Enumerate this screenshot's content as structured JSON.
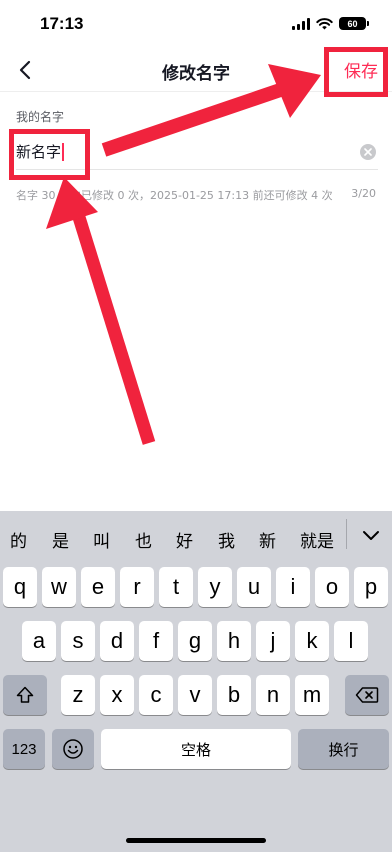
{
  "status_bar": {
    "time": "17:13",
    "battery": "60"
  },
  "nav": {
    "title": "修改名字",
    "save_label": "保存"
  },
  "form": {
    "label": "我的名字",
    "value": "新名字",
    "hint": "名字 30 天内已修改 0 次，2025-01-25 17:13 前还可修改 4 次",
    "count": "3/20"
  },
  "colors": {
    "accent": "#fe2c55",
    "annotation": "#f0233d",
    "keyboard_bg": "#d1d3d9"
  },
  "keyboard": {
    "candidates": [
      "的",
      "是",
      "叫",
      "也",
      "好",
      "我",
      "新",
      "就是"
    ],
    "row1": [
      "q",
      "w",
      "e",
      "r",
      "t",
      "y",
      "u",
      "i",
      "o",
      "p"
    ],
    "row2": [
      "a",
      "s",
      "d",
      "f",
      "g",
      "h",
      "j",
      "k",
      "l"
    ],
    "row3": [
      "z",
      "x",
      "c",
      "v",
      "b",
      "n",
      "m"
    ],
    "numbers_label": "123",
    "space_label": "空格",
    "return_label": "换行",
    "shift_icon": "shift-arrow-icon",
    "delete_icon": "backspace-icon",
    "emoji_icon": "emoji-face-icon"
  }
}
